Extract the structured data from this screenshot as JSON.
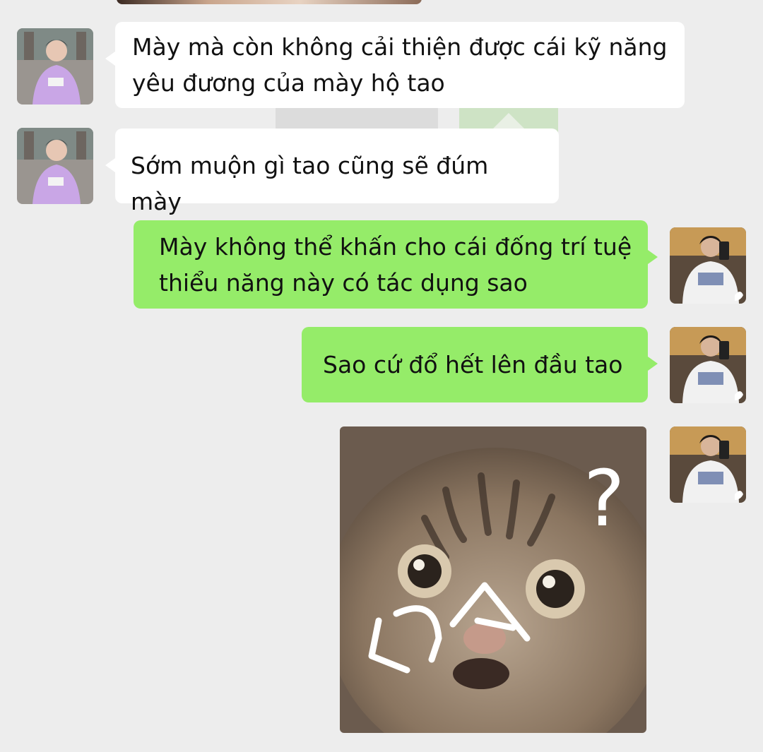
{
  "messages": [
    {
      "side": "in",
      "text": "Mày mà còn không cải thiện được cái kỹ năng\nyêu đương của mày hộ tao"
    },
    {
      "side": "in",
      "text": "Sớm muộn gì tao cũng sẽ đúm mày"
    },
    {
      "side": "out",
      "text": "Mày không thể khấn cho cái đống trí tuệ\nthiểu năng này có tác dụng sao"
    },
    {
      "side": "out",
      "text": "Sao cứ đổ hết lên đầu tao"
    }
  ],
  "sticker": {
    "icon": "confused-cat-sticker",
    "mark": "?"
  },
  "colors": {
    "background": "#ededed",
    "incoming": "#ffffff",
    "outgoing": "#95ec69"
  }
}
